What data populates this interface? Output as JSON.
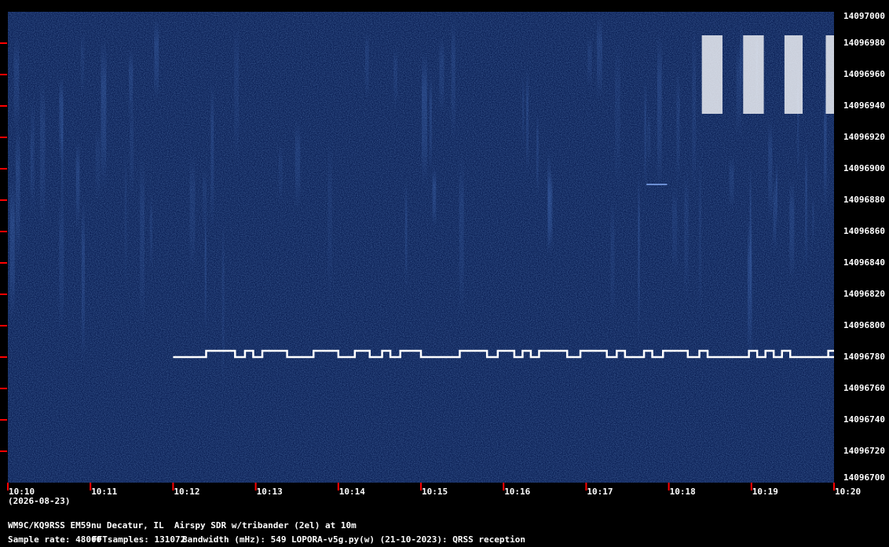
{
  "chart_data": {
    "type": "heatmap",
    "x_axis": {
      "unit": "time (UTC)",
      "range": [
        "10:10",
        "10:20"
      ],
      "ticks": [
        "10:10",
        "10:11",
        "10:12",
        "10:13",
        "10:14",
        "10:15",
        "10:16",
        "10:17",
        "10:18",
        "10:19",
        "10:20"
      ],
      "date_label": "(2026-08-23)"
    },
    "y_axis": {
      "unit": "frequency (Hz)",
      "range": [
        14096700,
        14097000
      ],
      "ticks": [
        "14097000",
        "14096980",
        "14096960",
        "14096940",
        "14096920",
        "14096900",
        "14096880",
        "14096860",
        "14096840",
        "14096820",
        "14096800",
        "14096780",
        "14096760",
        "14096740",
        "14096720",
        "14096700"
      ]
    },
    "colormap": {
      "background": "#0c2156",
      "signal": "#ffffff",
      "axis_ticks": "#ff0000"
    },
    "fsk_trace": {
      "low_hz": 14096780,
      "high_hz": 14096784,
      "start_time": "10:12",
      "end_time": "10:19:50",
      "high_segments_min": [
        [
          2.4,
          2.75
        ],
        [
          2.87,
          2.97
        ],
        [
          3.08,
          3.38
        ],
        [
          3.7,
          4.0
        ],
        [
          4.2,
          4.38
        ],
        [
          4.53,
          4.63
        ],
        [
          4.75,
          5.0
        ],
        [
          5.47,
          5.8
        ],
        [
          5.93,
          6.13
        ],
        [
          6.23,
          6.33
        ],
        [
          6.43,
          6.77
        ],
        [
          6.93,
          7.25
        ],
        [
          7.37,
          7.47
        ],
        [
          7.7,
          7.8
        ],
        [
          7.93,
          8.23
        ],
        [
          8.37,
          8.47
        ],
        [
          8.97,
          9.07
        ],
        [
          9.17,
          9.27
        ],
        [
          9.37,
          9.47
        ],
        [
          9.93,
          10.03
        ],
        [
          10.13,
          10.23
        ],
        [
          10.37,
          10.47
        ]
      ]
    },
    "signals": [
      {
        "label": "strong keyed carrier",
        "freq_range": [
          14096935,
          14096985
        ],
        "time_range_min": [
          8.4,
          10.2
        ]
      },
      {
        "label": "weak carrier",
        "freq_hz": 14096890,
        "time_range_min": [
          7.73,
          7.98
        ]
      }
    ]
  },
  "footer": {
    "station": "WM9C/KQ9RSS EM59nu Decatur, IL  Airspy SDR w/tribander (2el) at 10m",
    "sample_rate": "Sample rate: 48000",
    "fft_samples": "FFTsamples: 131072",
    "bandwidth": "Bandwidth (mHz): 549",
    "software": "LOPORA-v5g.py(w) (21-10-2023): QRSS reception"
  }
}
